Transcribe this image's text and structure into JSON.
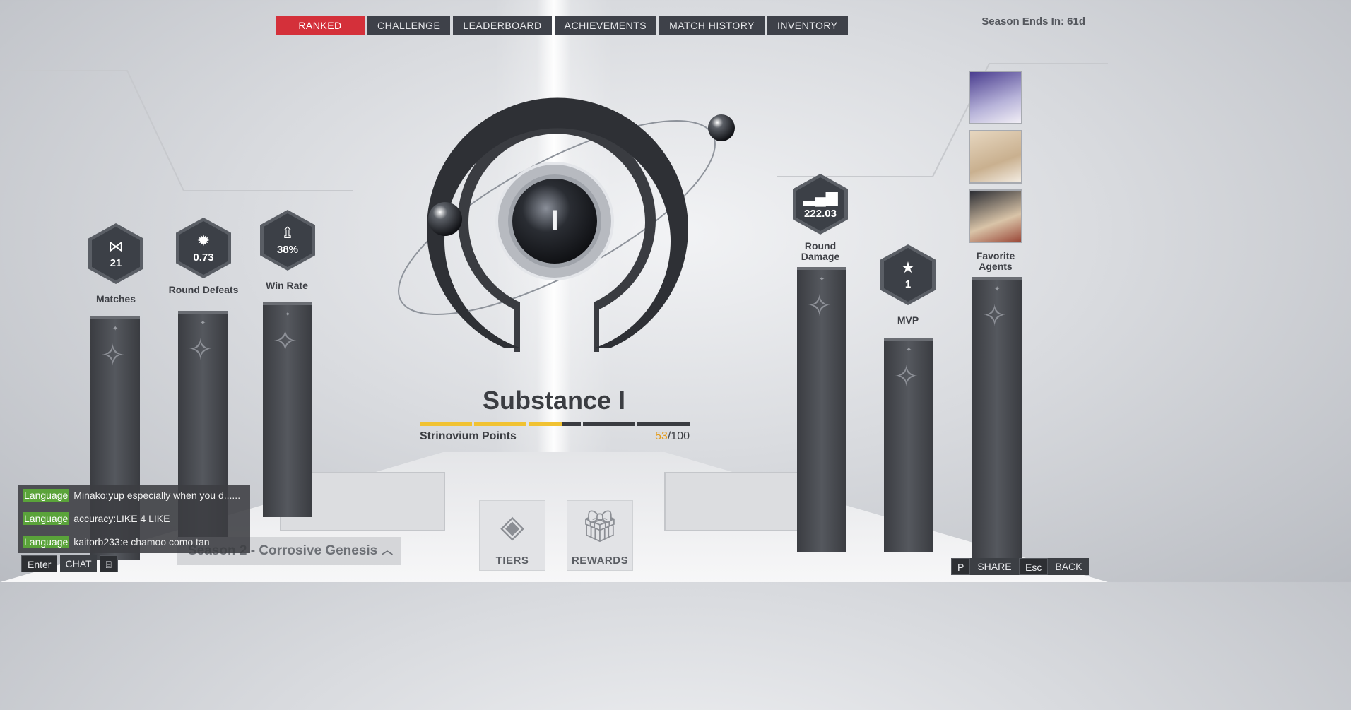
{
  "tabs": [
    {
      "label": "RANKED",
      "active": true
    },
    {
      "label": "CHALLENGE",
      "active": false
    },
    {
      "label": "LEADERBOARD",
      "active": false
    },
    {
      "label": "ACHIEVEMENTS",
      "active": false
    },
    {
      "label": "MATCH HISTORY",
      "active": false
    },
    {
      "label": "INVENTORY",
      "active": false
    }
  ],
  "season_end": "Season Ends In: 61d",
  "rank": {
    "numeral": "I",
    "title": "Substance I",
    "points_label": "Strinovium Points",
    "points_current": "53",
    "points_max": "/100",
    "progress_fraction": 0.53
  },
  "stats": {
    "matches": {
      "value": "21",
      "label": "Matches",
      "icon": "bowtie-icon"
    },
    "round_defeats": {
      "value": "0.73",
      "label": "Round Defeats",
      "icon": "burst-icon"
    },
    "win_rate": {
      "value": "38%",
      "label": "Win Rate",
      "icon": "up-arrow-icon"
    },
    "round_damage": {
      "value": "222.03",
      "label": "Round Damage",
      "icon": "bar-chart-icon"
    },
    "mvp": {
      "value": "1",
      "label": "MVP",
      "icon": "star-icon"
    }
  },
  "favorite_agents_label": "Favorite Agents",
  "buttons": {
    "tiers": "TIERS",
    "rewards": "REWARDS"
  },
  "season_selector": "Season 2 - Corrosive Genesis",
  "chat": {
    "lines": [
      {
        "tag": "Language",
        "text": "Minako:yup especially when you d......"
      },
      {
        "tag": "Language",
        "text": "accuracy:LIKE 4 LIKE"
      },
      {
        "tag": "Language",
        "text": "kaitorb233:e chamoo como tan"
      }
    ],
    "enter_key": "Enter",
    "chat_label": "CHAT"
  },
  "share": {
    "key": "P",
    "label": "SHARE"
  },
  "back": {
    "key": "Esc",
    "label": "BACK"
  },
  "colors": {
    "accent": "#d4303a",
    "progress": "#f1c232",
    "lang_tag": "#5aa33a"
  }
}
